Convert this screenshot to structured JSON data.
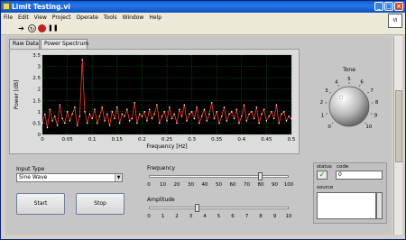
{
  "window": {
    "title": "Limit Testing.vi"
  },
  "menu": [
    "File",
    "Edit",
    "View",
    "Project",
    "Operate",
    "Tools",
    "Window",
    "Help"
  ],
  "tabs": [
    {
      "label": "Raw Data",
      "active": false
    },
    {
      "label": "Power Spectrum",
      "active": true
    }
  ],
  "tone": {
    "label": "Tone",
    "scale": [
      "0",
      "1",
      "2",
      "3",
      "4",
      "5",
      "6",
      "7",
      "8",
      "9",
      "10"
    ]
  },
  "input_type": {
    "label": "Input Type",
    "value": "Sine Wave"
  },
  "buttons": {
    "start": "Start",
    "stop": "Stop"
  },
  "frequency": {
    "label": "Frequency",
    "value": 80,
    "scale": [
      "0",
      "10",
      "20",
      "30",
      "40",
      "50",
      "60",
      "70",
      "80",
      "90",
      "100"
    ]
  },
  "amplitude": {
    "label": "Amplitude",
    "value": 3.5,
    "scale": [
      "0",
      "1",
      "2",
      "3",
      "4",
      "5",
      "6",
      "7",
      "8",
      "9",
      "10"
    ]
  },
  "error_cluster": {
    "status_label": "status",
    "code_label": "code",
    "code_value": "0",
    "source_label": "source",
    "status_ok": true
  },
  "colors": {
    "plot_bg": "#000000",
    "trace": "#ff3a1a",
    "grid": "#1f6f1f",
    "titlebar": "#0a5fd8"
  },
  "chart_data": {
    "type": "line",
    "xlabel": "Frequency [Hz]",
    "ylabel": "Power [dB]",
    "xlim": [
      0,
      0.5
    ],
    "ylim": [
      0,
      3.5
    ],
    "xticks": [
      "0",
      "0.05",
      "0.1",
      "0.15",
      "0.2",
      "0.25",
      "0.3",
      "0.35",
      "0.4",
      "0.45",
      "0.5"
    ],
    "yticks": [
      "0",
      "0.5",
      "1",
      "1.5",
      "2",
      "2.5",
      "3",
      "3.5"
    ],
    "grid": true,
    "x": [
      0.0,
      0.005,
      0.01,
      0.015,
      0.02,
      0.025,
      0.03,
      0.035,
      0.04,
      0.045,
      0.05,
      0.055,
      0.06,
      0.065,
      0.07,
      0.075,
      0.08,
      0.085,
      0.09,
      0.095,
      0.1,
      0.105,
      0.11,
      0.115,
      0.12,
      0.125,
      0.13,
      0.135,
      0.14,
      0.145,
      0.15,
      0.155,
      0.16,
      0.165,
      0.17,
      0.175,
      0.18,
      0.185,
      0.19,
      0.195,
      0.2,
      0.205,
      0.21,
      0.215,
      0.22,
      0.225,
      0.23,
      0.235,
      0.24,
      0.245,
      0.25,
      0.255,
      0.26,
      0.265,
      0.27,
      0.275,
      0.28,
      0.285,
      0.29,
      0.295,
      0.3,
      0.305,
      0.31,
      0.315,
      0.32,
      0.325,
      0.33,
      0.335,
      0.34,
      0.345,
      0.35,
      0.355,
      0.36,
      0.365,
      0.37,
      0.375,
      0.38,
      0.385,
      0.39,
      0.395,
      0.4,
      0.405,
      0.41,
      0.415,
      0.42,
      0.425,
      0.43,
      0.435,
      0.44,
      0.445,
      0.45,
      0.455,
      0.46,
      0.465,
      0.47,
      0.475,
      0.48,
      0.485,
      0.49,
      0.495,
      0.5
    ],
    "y": [
      0.5,
      0.9,
      0.3,
      1.1,
      0.6,
      0.8,
      0.4,
      1.3,
      0.7,
      0.5,
      1.0,
      0.6,
      0.9,
      1.2,
      0.4,
      0.8,
      3.3,
      1.0,
      0.5,
      0.9,
      0.7,
      1.1,
      0.5,
      0.8,
      1.2,
      0.6,
      0.9,
      0.4,
      1.0,
      0.7,
      1.2,
      0.5,
      0.9,
      0.8,
      1.1,
      0.6,
      0.7,
      1.4,
      0.5,
      0.9,
      0.8,
      1.0,
      0.6,
      1.1,
      0.7,
      0.9,
      1.3,
      0.5,
      0.8,
      1.0,
      0.6,
      1.2,
      0.7,
      0.9,
      0.5,
      1.1,
      0.8,
      1.3,
      0.6,
      0.9,
      1.0,
      0.7,
      1.2,
      0.5,
      0.8,
      1.1,
      0.6,
      0.9,
      1.4,
      0.7,
      1.0,
      0.5,
      0.8,
      1.2,
      0.6,
      0.9,
      1.0,
      0.7,
      1.1,
      0.5,
      0.8,
      1.3,
      0.6,
      0.9,
      1.0,
      0.7,
      1.2,
      0.5,
      0.9,
      1.1,
      0.6,
      0.8,
      1.0,
      0.7,
      1.3,
      0.5,
      0.9,
      1.0,
      0.6,
      0.8,
      0.7
    ]
  }
}
